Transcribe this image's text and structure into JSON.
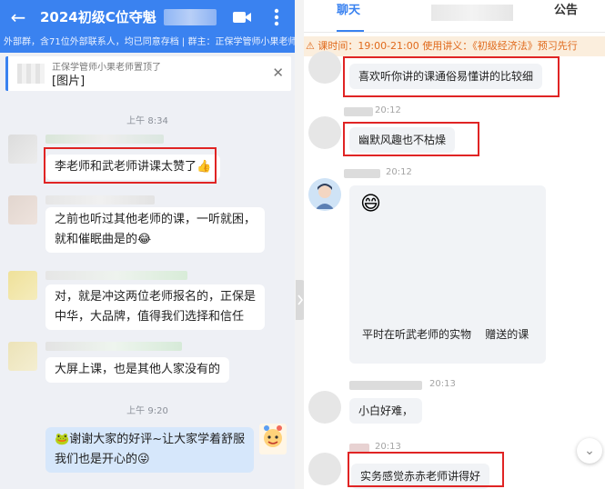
{
  "left": {
    "header": {
      "title": "2024初级C位夺魁",
      "back_icon": "arrow-left-icon",
      "video_icon": "video-camera-icon",
      "more_icon": "more-vertical-icon"
    },
    "notice": "外部群，含71位外部联系人，均已同意存档 | 群主：正保学管师小果老师",
    "pinned": {
      "top": "正保学管师小果老师置顶了",
      "body": "[图片]",
      "close_icon": "close-icon"
    },
    "messages": {
      "time1": "上午 8:34",
      "msg1": "李老师和武老师讲课太赞了",
      "msg2_line1": "之前也听过其他老师的课，一听就困，",
      "msg2_line2": "就和催眠曲是的",
      "msg3_line1": "对，就是冲这两位老师报名的，正保是",
      "msg3_line2": "中华，大品牌，值得我们选择和信任",
      "msg4": "大屏上课，也是其他人家没有的",
      "time2": "上午 9:20",
      "my_msg_line1": "谢谢大家的好评~让大家学着舒服",
      "my_msg_line2": "我们也是开心的"
    },
    "emojis": {
      "thumbs": "👍",
      "laugh": "😂",
      "frog": "🐸",
      "tongue": "😜"
    }
  },
  "right": {
    "tabs": {
      "chat": "聊天",
      "notice": "公告"
    },
    "marquee": "课时间：19:00-21:00 使用讲义：《初级经济法》预习先行",
    "messages": {
      "m1": "喜欢听你讲的课通俗易懂讲的比较细",
      "t2": "20:12",
      "m2": "幽默风趣也不枯燥",
      "t3": "20:12",
      "m3_emoji": "😄",
      "m3_text": "平时在听武老师的实物    赠送的课",
      "t4": "20:13",
      "m4": "小白好难，",
      "t5": "20:13",
      "m5": "实务感觉赤赤老师讲得好"
    },
    "scroll_icon": "chevron-down-icon"
  }
}
